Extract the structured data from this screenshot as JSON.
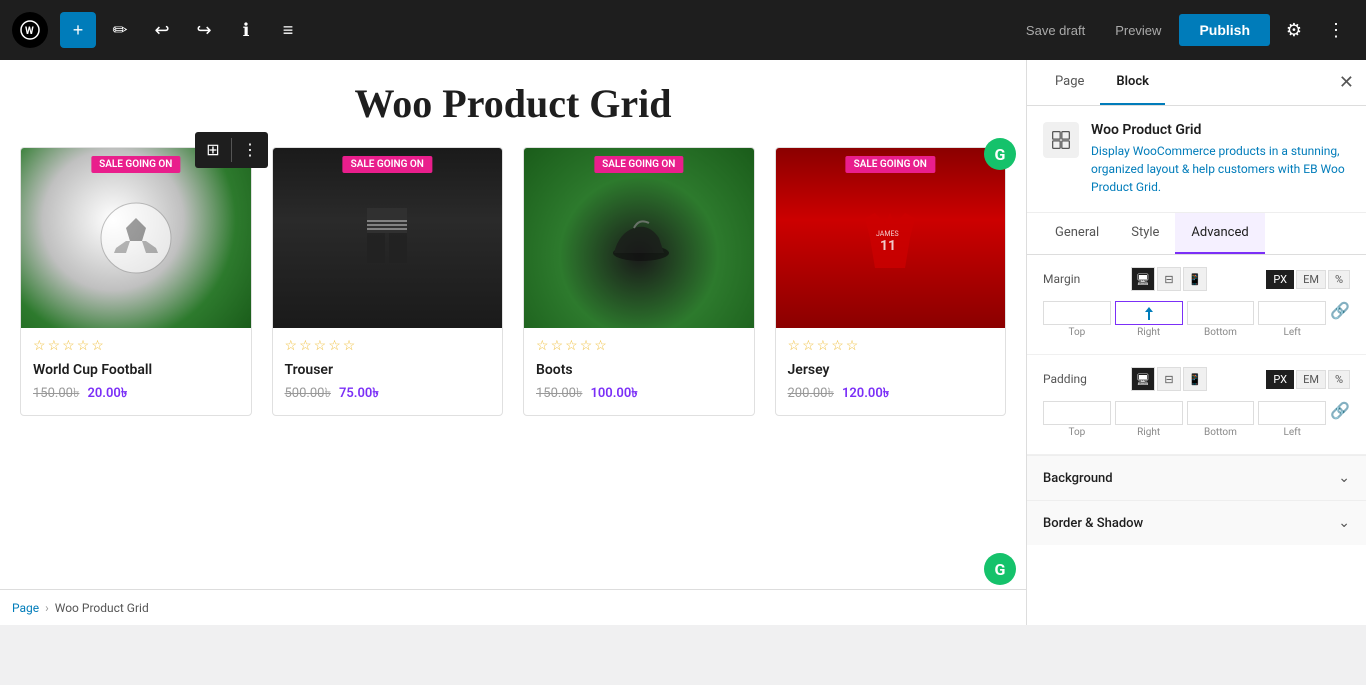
{
  "toolbar": {
    "wp_logo": "W",
    "add_label": "+",
    "edit_label": "✏",
    "undo_label": "↩",
    "redo_label": "↪",
    "info_label": "ℹ",
    "list_label": "≡",
    "save_draft_label": "Save draft",
    "preview_label": "Preview",
    "publish_label": "Publish",
    "gear_label": "⚙",
    "more_label": "⋮"
  },
  "page": {
    "title": "Woo Product Grid",
    "breadcrumb_root": "Page",
    "breadcrumb_current": "Woo Product Grid"
  },
  "block_toolbar": {
    "grid_icon": "⊞",
    "more_icon": "⋮"
  },
  "products": [
    {
      "id": 1,
      "sale_badge": "SALE GOING ON",
      "name": "World Cup Football",
      "old_price": "150.00",
      "new_price": "20.00",
      "currency": "৳",
      "stars": 5,
      "image_class": "img-ball"
    },
    {
      "id": 2,
      "sale_badge": "SALE GOING ON",
      "name": "Trouser",
      "old_price": "500.00",
      "new_price": "75.00",
      "currency": "৳",
      "stars": 5,
      "image_class": "img-trouser"
    },
    {
      "id": 3,
      "sale_badge": "SALE GOING ON",
      "name": "Boots",
      "old_price": "150.00",
      "new_price": "100.00",
      "currency": "৳",
      "stars": 5,
      "image_class": "img-boots"
    },
    {
      "id": 4,
      "sale_badge": "SALE GOING ON",
      "name": "Jersey",
      "old_price": "200.00",
      "new_price": "120.00",
      "currency": "৳",
      "stars": 5,
      "image_class": "img-jersey"
    }
  ],
  "right_panel": {
    "tab_page": "Page",
    "tab_block": "Block",
    "close_icon": "✕",
    "block_title": "Woo Product Grid",
    "block_desc_1": "Display WooCommerce products in a stunning, organized layout & help customers with ",
    "block_desc_link": "EB Woo Product Grid",
    "block_desc_2": ".",
    "sub_tab_general": "General",
    "sub_tab_style": "Style",
    "sub_tab_advanced": "Advanced",
    "margin_label": "Margin",
    "padding_label": "Padding",
    "unit_px": "PX",
    "unit_em": "EM",
    "unit_pct": "%",
    "top_label": "Top",
    "right_label": "Right",
    "bottom_label": "Bottom",
    "left_label": "Left",
    "background_label": "Background",
    "border_shadow_label": "Border & Shadow",
    "chevron_down": "⌄",
    "link_icon": "🔗",
    "device_desktop": "🖥",
    "device_tablet": "⊟",
    "device_mobile": "📱"
  },
  "grammarly": {
    "icon": "G"
  }
}
